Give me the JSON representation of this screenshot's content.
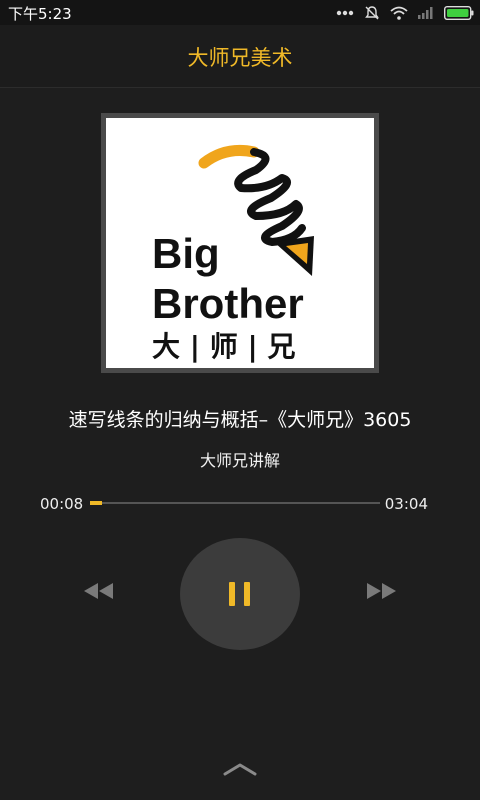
{
  "status_bar": {
    "time": "下午5:23",
    "icons": [
      "dots-icon",
      "mute-bell-icon",
      "wifi-icon",
      "signal-icon",
      "battery-icon"
    ]
  },
  "app": {
    "title": "大师兄美术",
    "accent_color": "#f0b928"
  },
  "cover": {
    "logo_text_line1": "Big",
    "logo_text_line2": "Brother",
    "logo_chinese": "大 | 师 | 兄"
  },
  "track": {
    "title": "速写线条的归纳与概括–《大师兄》3605",
    "artist": "大师兄讲解"
  },
  "playback": {
    "elapsed": "00:08",
    "total": "03:04",
    "progress_fraction": 0.043,
    "state": "playing"
  },
  "controls": {
    "prev_icon": "rewind-icon",
    "play_pause_icon": "pause-icon",
    "next_icon": "fast-forward-icon",
    "expand_icon": "chevron-up-icon"
  }
}
